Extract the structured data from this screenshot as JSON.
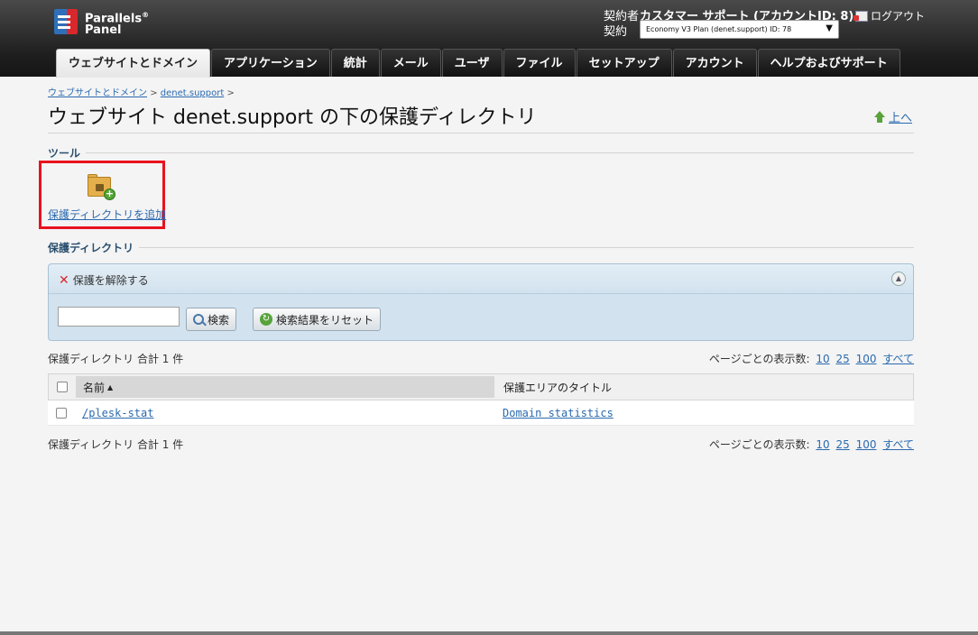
{
  "header": {
    "logo_line1": "Parallels",
    "logo_sup": "®",
    "logo_line2": "Panel",
    "account_label": "契約者",
    "account_value": "カスタマー サポート (アカウントID: 8)",
    "plan_label": "契約",
    "plan_value": "Economy V3 Plan (denet.support) ID: 78",
    "logout": "ログアウト"
  },
  "tabs": [
    {
      "label": "ウェブサイトとドメイン"
    },
    {
      "label": "アプリケーション"
    },
    {
      "label": "統計"
    },
    {
      "label": "メール"
    },
    {
      "label": "ユーザ"
    },
    {
      "label": "ファイル"
    },
    {
      "label": "セットアップ"
    },
    {
      "label": "アカウント"
    },
    {
      "label": "ヘルプおよびサポート"
    }
  ],
  "breadcrumb": {
    "item1": "ウェブサイトとドメイン",
    "item2": "denet.support",
    "sep": ">"
  },
  "page_title": "ウェブサイト denet.support の下の保護ディレクトリ",
  "up_link": "上へ",
  "tools": {
    "section": "ツール",
    "add_protected_dir": "保護ディレクトリを追加"
  },
  "list": {
    "section": "保護ディレクトリ",
    "unprotect": "保護を解除する",
    "search_value": "",
    "search_button": "検索",
    "reset_button": "検索結果をリセット",
    "summary": "保護ディレクトリ 合計 1 件",
    "per_page_label": "ページごとの表示数:",
    "per_page_options": [
      "10",
      "25",
      "100",
      "すべて"
    ],
    "columns": {
      "name": "名前",
      "title": "保護エリアのタイトル"
    },
    "rows": [
      {
        "name": "/plesk-stat",
        "title": "Domain statistics"
      }
    ]
  },
  "colors": {
    "accent_link": "#2a6ab0",
    "highlight_box": "#e8121e",
    "panel_bg": "#d2e2ee"
  }
}
